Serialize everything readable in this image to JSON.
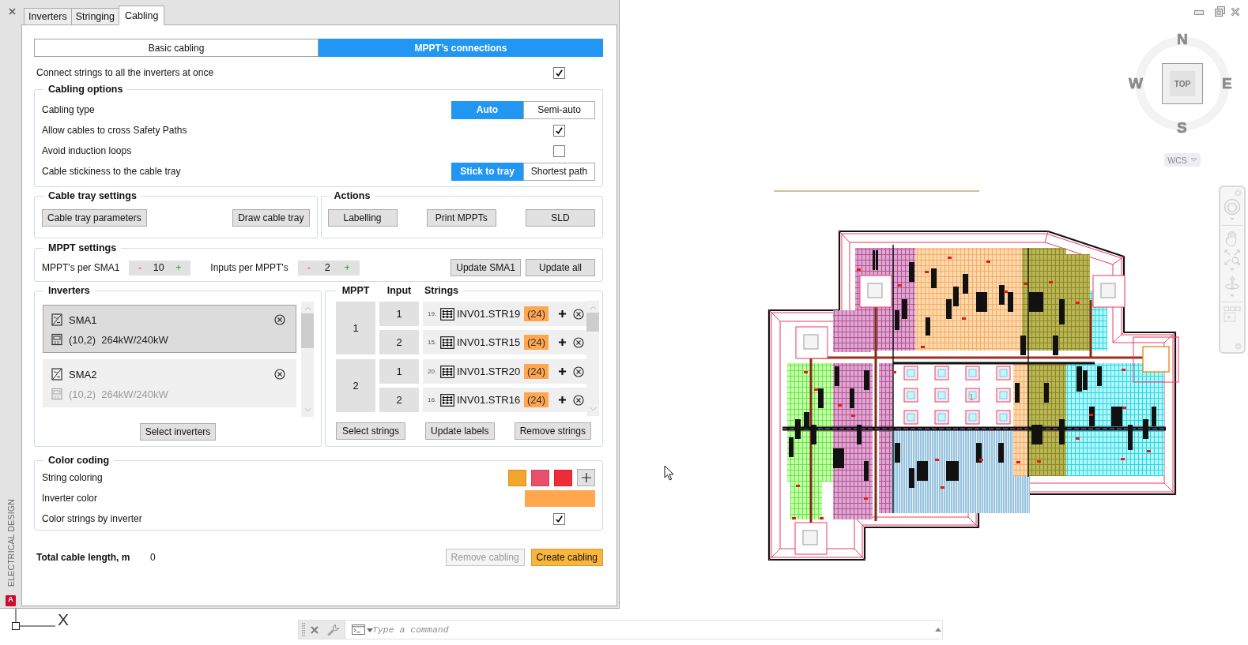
{
  "palette": {
    "title": "ELECTRICAL DESIGN",
    "app_badge": "A",
    "tabs": [
      {
        "label": "Inverters",
        "selected": false
      },
      {
        "label": "Stringing",
        "selected": false
      },
      {
        "label": "Cabling",
        "selected": true
      }
    ],
    "mode_tabs": [
      {
        "label": "Basic cabling",
        "selected": false
      },
      {
        "label": "MPPT’s connections",
        "selected": true
      }
    ],
    "connect_all": {
      "label": "Connect strings to all the inverters at once",
      "checked": true
    },
    "cabling_options": {
      "title": "Cabling options",
      "rows": [
        {
          "kind": "toggle",
          "label": "Cabling type",
          "options": [
            {
              "label": "Auto",
              "selected": true
            },
            {
              "label": "Semi-auto",
              "selected": false
            }
          ]
        },
        {
          "kind": "checkbox",
          "label": "Allow cables to cross Safety Paths",
          "checked": true
        },
        {
          "kind": "checkbox",
          "label": "Avoid induction loops",
          "checked": false
        },
        {
          "kind": "toggle",
          "label": "Cable stickiness to the cable tray",
          "options": [
            {
              "label": "Stick to tray",
              "selected": true
            },
            {
              "label": "Shortest path",
              "selected": false
            }
          ]
        }
      ]
    },
    "cable_tray_settings": {
      "title": "Cable tray settings",
      "buttons": [
        "Cable tray parameters",
        "Draw cable tray"
      ]
    },
    "actions": {
      "title": "Actions",
      "buttons": [
        "Labelling",
        "Print MPPTs",
        "SLD"
      ]
    },
    "mppt_settings": {
      "title": "MPPT settings",
      "steppers": [
        {
          "label": "MPPT's per SMA1",
          "decrement": "-",
          "value": "10",
          "increment": "+"
        },
        {
          "label": "Inputs per MPPT's",
          "decrement": "-",
          "value": "2",
          "increment": "+"
        }
      ],
      "buttons": [
        "Update SMA1",
        "Update all"
      ]
    },
    "inverters": {
      "title": "Inverters",
      "items": [
        {
          "name": "SMA1",
          "details": "(10,2)  264kW/240kW",
          "selected": true
        },
        {
          "name": "SMA2",
          "details": "(10,2)  264kW/240kW",
          "selected": false
        }
      ],
      "button": "Select inverters"
    },
    "mppt_connections": {
      "columns": [
        "MPPT",
        "Input",
        "Strings"
      ],
      "mppts": [
        {
          "number": "1",
          "inputs": [
            {
              "number": "1",
              "index": "19.",
              "string": "INV01.STR19",
              "modules": "(24)"
            },
            {
              "number": "2",
              "index": "15.",
              "string": "INV01.STR15",
              "modules": "(24)"
            }
          ]
        },
        {
          "number": "2",
          "inputs": [
            {
              "number": "1",
              "index": "20.",
              "string": "INV01.STR20",
              "modules": "(24)"
            },
            {
              "number": "2",
              "index": "16.",
              "string": "INV01.STR16",
              "modules": "(24)"
            }
          ]
        }
      ],
      "buttons": [
        "Select strings",
        "Update labels",
        "Remove strings"
      ]
    },
    "color_coding": {
      "title": "Color coding",
      "rows": [
        {
          "kind": "swatches",
          "label": "String coloring",
          "swatches": [
            {
              "color": "#f2a62a"
            },
            {
              "color": "#e9506c"
            },
            {
              "color": "#ee2c36"
            }
          ]
        },
        {
          "kind": "color",
          "label": "Inverter color",
          "color": "#ffa64f"
        },
        {
          "kind": "checkbox",
          "label": "Color strings by inverter",
          "checked": true
        }
      ]
    },
    "footer": {
      "label": "Total cable length, m",
      "value": "0",
      "buttons": [
        {
          "label": "Remove cabling",
          "disabled": true
        },
        {
          "label": "Create cabling",
          "disabled": false
        }
      ]
    }
  },
  "canvas": {
    "compass": {
      "north": "N",
      "west": "W",
      "east": "E",
      "south": "S",
      "face": "TOP"
    },
    "ucs_menu": "WCS",
    "site_plan": {
      "block_label": "1"
    },
    "ucs_icon": {
      "axis": "X"
    },
    "command_line": {
      "placeholder": "Type a command"
    }
  }
}
